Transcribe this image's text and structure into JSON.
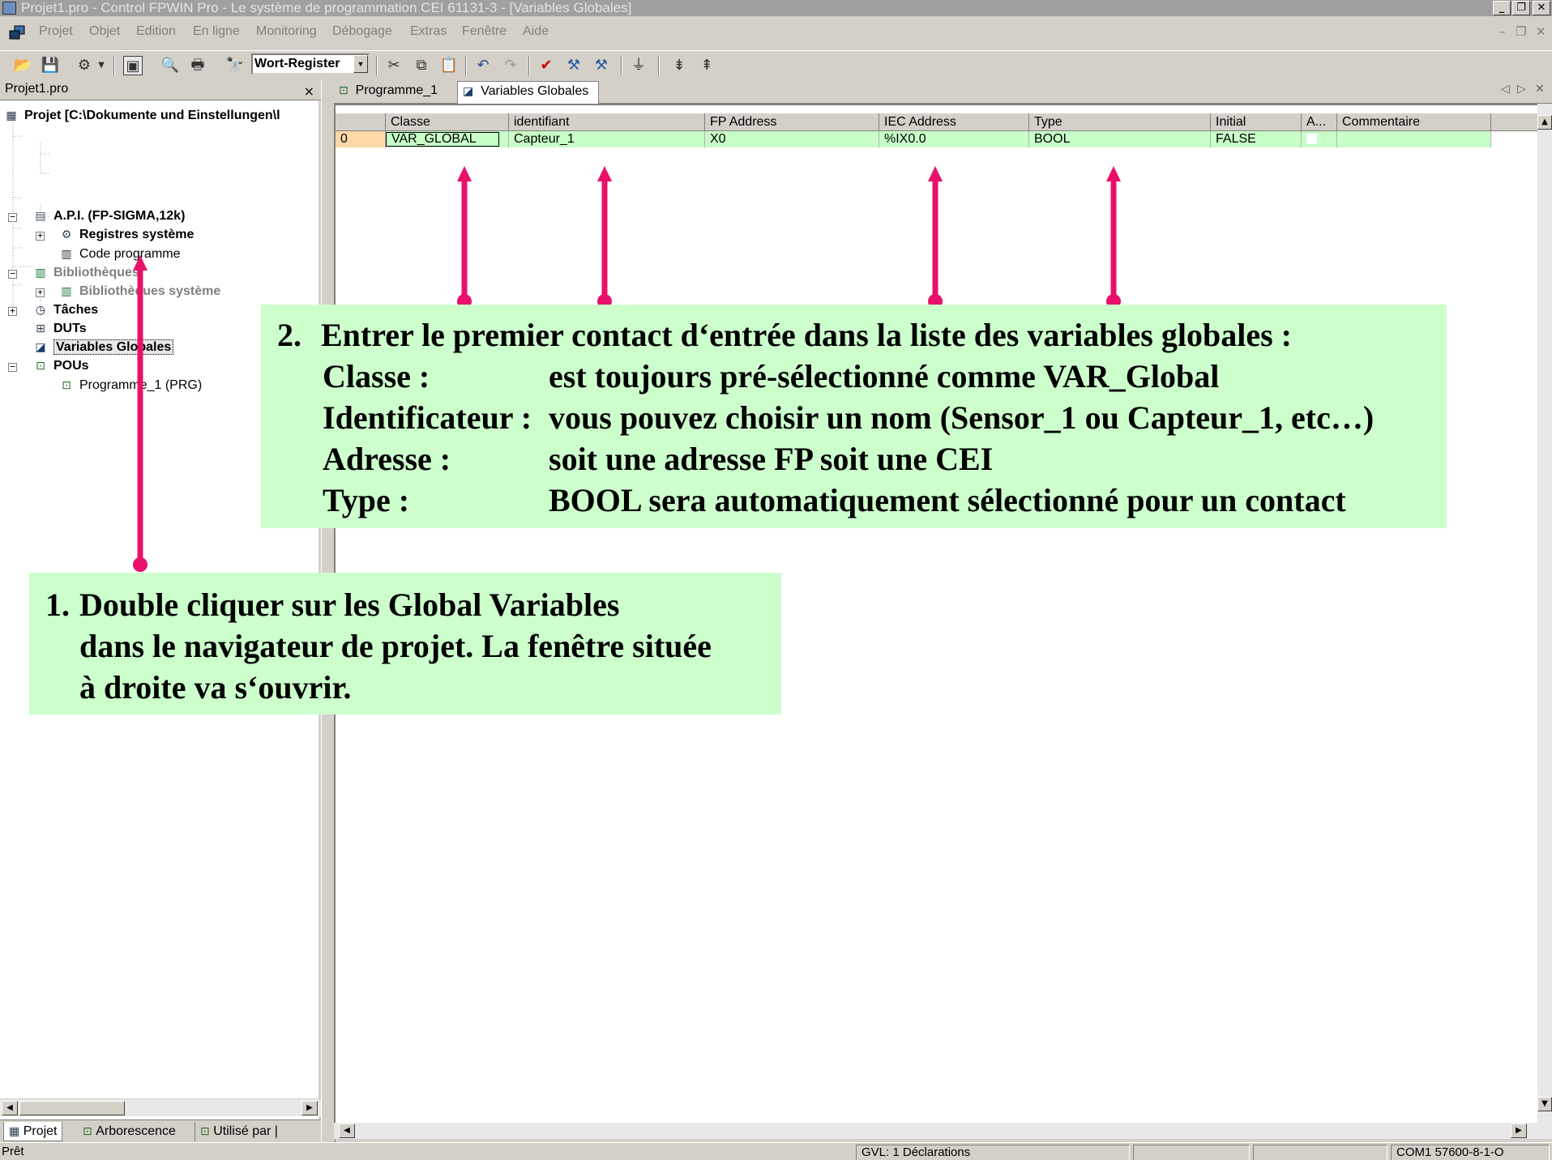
{
  "window": {
    "title": "Projet1.pro - Control FPWIN Pro - Le système de programmation CEI 61131-3 - [Variables Globales]",
    "controls": {
      "minimize": "_",
      "restore": "❐",
      "close": "✕"
    }
  },
  "menubar": {
    "items": [
      "Projet",
      "Objet",
      "Edition",
      "En ligne",
      "Monitoring",
      "Débogage",
      "Extras",
      "Fenêtre",
      "Aide"
    ],
    "mdi_controls": {
      "minimize": "–",
      "restore": "❐",
      "close": "✕"
    }
  },
  "toolbar": {
    "search_combo_value": "Wort-Register",
    "icons": [
      "open-icon",
      "save-icon",
      "compile-icon",
      "navigator-icon",
      "print-preview-icon",
      "print-icon",
      "find-icon",
      "cut-icon",
      "copy-icon",
      "paste-icon",
      "undo-icon",
      "redo-icon",
      "check-icon",
      "build-icon",
      "rebuild-icon",
      "online-icon",
      "insert-line-icon",
      "append-line-icon"
    ]
  },
  "left_pane": {
    "title": "Projet1.pro",
    "close": "×",
    "tree": [
      {
        "label": "Projet [C:\\Dokumente und Einstellungen\\l",
        "bold": true,
        "grey": false
      },
      {
        "label": "A.P.I. (FP-SIGMA,12k)",
        "bold": true,
        "grey": false
      },
      {
        "label": "Registres système",
        "bold": true,
        "grey": false
      },
      {
        "label": "Code programme",
        "bold": false,
        "grey": false
      },
      {
        "label": "Bibliothèques",
        "bold": true,
        "grey": true
      },
      {
        "label": "Bibliothèques système",
        "bold": true,
        "grey": true
      },
      {
        "label": "Tâches",
        "bold": true,
        "grey": false
      },
      {
        "label": "DUTs",
        "bold": true,
        "grey": false
      },
      {
        "label": "Variables Globales",
        "bold": true,
        "grey": false
      },
      {
        "label": "POUs",
        "bold": true,
        "grey": false
      },
      {
        "label": "Programme_1 (PRG)",
        "bold": false,
        "grey": false
      }
    ],
    "bottom_tabs": [
      "Projet",
      "Arborescence",
      "Utilisé par"
    ]
  },
  "document_tabs": [
    {
      "label": "Programme_1",
      "active": false
    },
    {
      "label": "Variables Globales",
      "active": true
    }
  ],
  "tab_nav": {
    "prev": "◁",
    "next": "▷",
    "close": "✕"
  },
  "grid": {
    "columns": [
      "Classe",
      "identifiant",
      "FP Address",
      "IEC Address",
      "Type",
      "Initial",
      "A...",
      "Commentaire"
    ],
    "rows": [
      {
        "index": "0",
        "classe": "VAR_GLOBAL",
        "identifiant": "Capteur_1",
        "fp_address": "X0",
        "iec_address": "%IX0.0",
        "type": "BOOL",
        "initial": "FALSE",
        "a": "",
        "commentaire": ""
      }
    ]
  },
  "statusbar": {
    "ready": "Prêt",
    "declarations": "GVL: 1 Déclarations",
    "connection": "COM1 57600-8-1-O"
  },
  "annotations": {
    "callout2": {
      "heading_num": "2.",
      "heading": "Entrer le premier contact d‘entrée dans la liste des variables globales :",
      "rows": [
        {
          "label": "Classe :",
          "value": "est toujours pré-sélectionné comme VAR_Global"
        },
        {
          "label": "Identificateur :",
          "value": "vous pouvez choisir un nom (Sensor_1 ou Capteur_1, etc…)"
        },
        {
          "label": "Adresse :",
          "value": "soit une adresse FP soit une CEI"
        },
        {
          "label": "Type :",
          "value": "BOOL sera automatiquement sélectionné pour un contact"
        }
      ]
    },
    "callout1": {
      "num": "1.",
      "lines": [
        "Double cliquer sur les Global Variables",
        "dans le navigateur de projet. La fenêtre située",
        "à droite va s‘ouvrir."
      ]
    },
    "accent_color": "#e8106b"
  }
}
